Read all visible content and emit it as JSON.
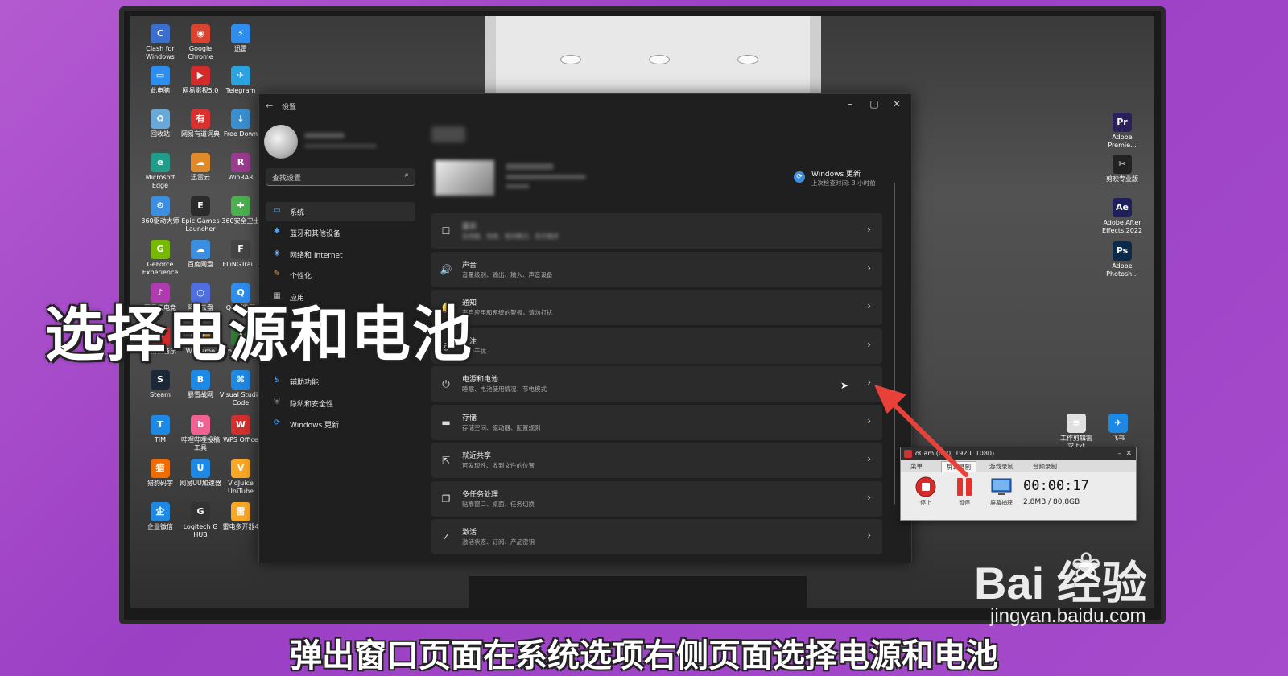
{
  "desktop": {
    "icons": [
      {
        "label": "Clash for Windows",
        "color": "#3a6fd0",
        "glyph": "C"
      },
      {
        "label": "Google Chrome",
        "color": "#d9432f",
        "glyph": "◉"
      },
      {
        "label": "迅雷",
        "color": "#2d8ef0",
        "glyph": "⚡"
      },
      {
        "label": "此电脑",
        "color": "#2d8ef0",
        "glyph": "▭"
      },
      {
        "label": "网易影视5.0",
        "color": "#d12b2b",
        "glyph": "▶"
      },
      {
        "label": "Telegram",
        "color": "#2aa3e0",
        "glyph": "✈"
      },
      {
        "label": "回收站",
        "color": "#6aa8d8",
        "glyph": "♻"
      },
      {
        "label": "网易有道词典",
        "color": "#d93030",
        "glyph": "有"
      },
      {
        "label": "Free Down",
        "color": "#3a8fd0",
        "glyph": "↓"
      },
      {
        "label": "Microsoft Edge",
        "color": "#1f9d8a",
        "glyph": "e"
      },
      {
        "label": "迅雷云",
        "color": "#e08a2a",
        "glyph": "☁"
      },
      {
        "label": "WinRAR",
        "color": "#9a3b8e",
        "glyph": "R"
      },
      {
        "label": "360驱动大师",
        "color": "#3b8ee0",
        "glyph": "⚙"
      },
      {
        "label": "Epic Games Launcher",
        "color": "#2b2b2b",
        "glyph": "E"
      },
      {
        "label": "360安全卫士",
        "color": "#4caf50",
        "glyph": "✚"
      },
      {
        "label": "GeForce Experience",
        "color": "#76b900",
        "glyph": "G"
      },
      {
        "label": "百度网盘",
        "color": "#3b8ee0",
        "glyph": "☁"
      },
      {
        "label": "FLiNGTrai...",
        "color": "#444444",
        "glyph": "F"
      },
      {
        "label": "网易云电竞",
        "color": "#b03bb0",
        "glyph": "♪"
      },
      {
        "label": "阿里云盘",
        "color": "#4f6fe0",
        "glyph": "○"
      },
      {
        "label": "QQ浏览器",
        "color": "#2d8ef0",
        "glyph": "Q"
      },
      {
        "label": "网易云音乐",
        "color": "#d12b2b",
        "glyph": "♫"
      },
      {
        "label": "WeGame",
        "color": "#e0a02a",
        "glyph": "W"
      },
      {
        "label": "amdclean...",
        "color": "#2e7d32",
        "glyph": "A"
      },
      {
        "label": "Steam",
        "color": "#1b2838",
        "glyph": "S"
      },
      {
        "label": "暴雪战网",
        "color": "#1e88e5",
        "glyph": "B"
      },
      {
        "label": "Visual Studio Code",
        "color": "#1e88e5",
        "glyph": "⌘"
      },
      {
        "label": "TIM",
        "color": "#1e88e5",
        "glyph": "T"
      },
      {
        "label": "哔哩哔哩投稿工具",
        "color": "#f06292",
        "glyph": "b"
      },
      {
        "label": "WPS Office",
        "color": "#d32f2f",
        "glyph": "W"
      },
      {
        "label": "猎豹码字",
        "color": "#ef6c00",
        "glyph": "猎"
      },
      {
        "label": "网易UU加速器",
        "color": "#1e88e5",
        "glyph": "U"
      },
      {
        "label": "VidJuice UniTube",
        "color": "#f9a825",
        "glyph": "V"
      },
      {
        "label": "企业微信",
        "color": "#1e88e5",
        "glyph": "企"
      },
      {
        "label": "Logitech G HUB",
        "color": "#333333",
        "glyph": "G"
      },
      {
        "label": "雷电多开器4",
        "color": "#f9a825",
        "glyph": "雷"
      },
      {
        "label": "Adobe Premie...",
        "color": "#2b1f5c",
        "glyph": "Pr"
      },
      {
        "label": "剪映专业版",
        "color": "#222222",
        "glyph": "✂"
      },
      {
        "label": "Adobe After Effects 2022",
        "color": "#1f1f5c",
        "glyph": "Ae"
      },
      {
        "label": "Adobe Photosh...",
        "color": "#0b2a4a",
        "glyph": "Ps"
      },
      {
        "label": "工作剪辑需求.txt",
        "color": "#e0e0e0",
        "glyph": "≡"
      },
      {
        "label": "飞书",
        "color": "#1e88e5",
        "glyph": "✈"
      }
    ]
  },
  "settings": {
    "title": "设置",
    "search_placeholder": "查找设置",
    "nav": [
      {
        "label": "系统",
        "icon": "monitor-icon",
        "glyph": "▭",
        "color": "#4aa3ff",
        "active": true
      },
      {
        "label": "蓝牙和其他设备",
        "icon": "bluetooth-icon",
        "glyph": "✱",
        "color": "#4aa3ff",
        "active": false
      },
      {
        "label": "网络和 Internet",
        "icon": "wifi-icon",
        "glyph": "◈",
        "color": "#7fb8ff",
        "active": false
      },
      {
        "label": "个性化",
        "icon": "brush-icon",
        "glyph": "✎",
        "color": "#f0a040",
        "active": false
      },
      {
        "label": "应用",
        "icon": "apps-icon",
        "glyph": "▦",
        "color": "#bbbbbb",
        "active": false
      },
      {
        "label": "辅助功能",
        "icon": "accessibility-icon",
        "glyph": "♿",
        "color": "#4aa3ff",
        "active": false
      },
      {
        "label": "隐私和安全性",
        "icon": "shield-icon",
        "glyph": "⛨",
        "color": "#999999",
        "active": false
      },
      {
        "label": "Windows 更新",
        "icon": "update-icon",
        "glyph": "⟳",
        "color": "#4aa3ff",
        "active": false
      }
    ],
    "update": {
      "label": "Windows 更新",
      "sub": "上次检查时间: 3 小时前"
    },
    "rows": [
      {
        "title": "显示",
        "sub": "监视器、亮度、夜间模式、显示描述",
        "icon": "display-icon",
        "glyph": "☐",
        "blurred": true
      },
      {
        "title": "声音",
        "sub": "音量级别、输出、输入、声音设备",
        "icon": "speaker-icon",
        "glyph": "🔊",
        "blurred": false
      },
      {
        "title": "通知",
        "sub": "来自应用和系统的警报，请勿打扰",
        "icon": "bell-icon",
        "glyph": "🔔",
        "blurred": false
      },
      {
        "title": "专注",
        "sub": "减少干扰",
        "icon": "focus-icon",
        "glyph": "◎",
        "blurred": false
      },
      {
        "title": "电源和电池",
        "sub": "睡眠、电池使用情况、节电模式",
        "icon": "power-icon",
        "glyph": "⏻",
        "blurred": false
      },
      {
        "title": "存储",
        "sub": "存储空间、驱动器、配置规则",
        "icon": "storage-icon",
        "glyph": "▬",
        "blurred": false
      },
      {
        "title": "就近共享",
        "sub": "可发现性、收到文件的位置",
        "icon": "share-icon",
        "glyph": "⇱",
        "blurred": false
      },
      {
        "title": "多任务处理",
        "sub": "贴靠窗口、桌面、任务切换",
        "icon": "multitask-icon",
        "glyph": "❐",
        "blurred": false
      },
      {
        "title": "激活",
        "sub": "激活状态、订阅、产品密钥",
        "icon": "check-circle-icon",
        "glyph": "✓",
        "blurred": false
      }
    ]
  },
  "ocam": {
    "title": "oCam (0, 0, 1920, 1080)",
    "tabs": [
      "菜单",
      "屏幕录制",
      "游戏录制",
      "音频录制"
    ],
    "selected_tab": "屏幕录制",
    "buttons": [
      {
        "label": "停止",
        "icon": "stop-icon"
      },
      {
        "label": "暂停",
        "icon": "pause-icon"
      },
      {
        "label": "屏幕捕获",
        "icon": "screenshot-icon"
      }
    ],
    "time": "00:00:17",
    "size": "2.8MB / 80.8GB"
  },
  "overlay": {
    "caption": "选择电源和电池",
    "subtitle": "弹出窗口页面在系统选项右侧页面选择电源和电池",
    "watermark_brand": "Bai 经验",
    "watermark_url": "jingyan.baidu.com",
    "arrow_color": "#e8413a"
  }
}
